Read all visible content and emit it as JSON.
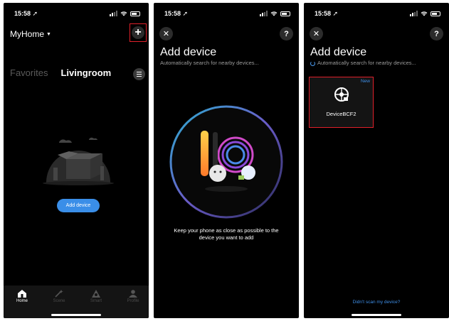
{
  "status_bar": {
    "time": "15:58 ➚"
  },
  "screen1": {
    "home_name": "MyHome",
    "tabs": [
      "Favorites",
      "Livingroom"
    ],
    "add_device_button": "Add device",
    "tabbar": [
      {
        "label": "Home",
        "icon": "home-icon"
      },
      {
        "label": "Scene",
        "icon": "scene-wand-icon"
      },
      {
        "label": "Smart",
        "icon": "smart-triangle-icon"
      },
      {
        "label": "Profile",
        "icon": "profile-icon"
      }
    ]
  },
  "screen2": {
    "title": "Add device",
    "subtitle": "Automatically search for nearby devices...",
    "hint_line1": "Keep your phone as close as possible to the",
    "hint_line2": "device you want to add"
  },
  "screen3": {
    "title": "Add device",
    "subtitle": "Automatically search for nearby devices...",
    "device": {
      "badge": "New",
      "name": "DeviceBCF2",
      "icon": "robot-vacuum-icon"
    },
    "not_found_link": "Didn't scan my device?"
  },
  "colors": {
    "accent": "#3a8ee8",
    "highlight_box": "#e0202a",
    "background": "#000000"
  }
}
